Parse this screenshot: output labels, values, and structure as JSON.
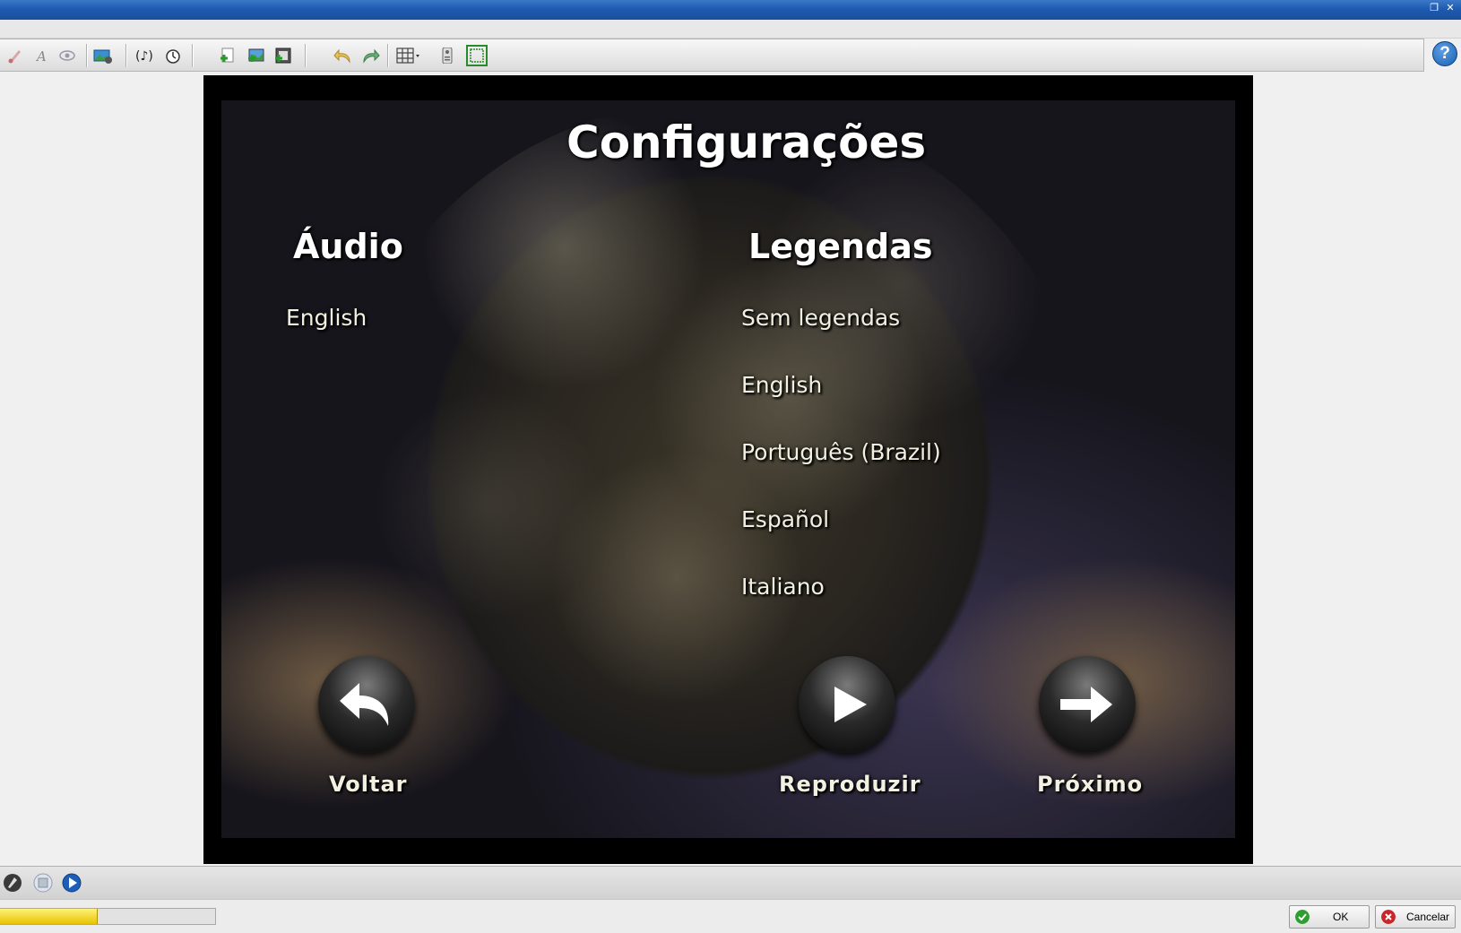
{
  "window": {
    "controls": [
      "restore",
      "close"
    ]
  },
  "toolbar": {
    "icons": [
      "brush-icon",
      "text-icon",
      "eye-icon",
      "image-settings-icon",
      "audio-icon",
      "timer-icon",
      "add-page-icon",
      "add-image-icon",
      "add-film-icon",
      "undo-icon",
      "redo-icon",
      "grid-icon",
      "remote-icon",
      "safe-area-icon"
    ],
    "help_label": "?"
  },
  "menu": {
    "title": "Configurações",
    "audio_heading": "Áudio",
    "subtitles_heading": "Legendas",
    "audio_items": [
      "English"
    ],
    "subtitle_items": [
      "Sem legendas",
      "English",
      "Português (Brazil)",
      "Español",
      "Italiano"
    ],
    "buttons": {
      "back": "Voltar",
      "play": "Reproduzir",
      "next": "Próximo"
    }
  },
  "playback": {
    "progress_percent": 45
  },
  "dialog": {
    "ok_label": "OK",
    "cancel_label": "Cancelar"
  },
  "colors": {
    "titlebar": "#1f5bb0",
    "ok_icon": "#2e9e2e",
    "cancel_icon": "#c8262a",
    "progress_fill": "#e7c300"
  }
}
